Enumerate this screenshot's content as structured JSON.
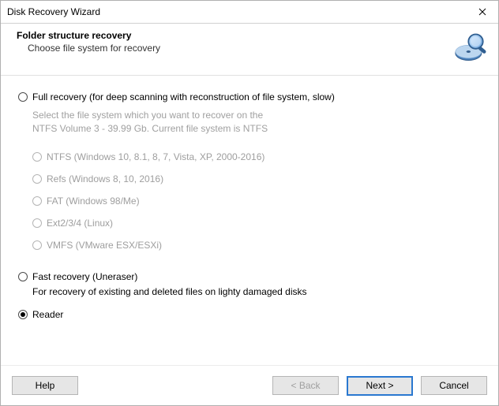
{
  "window": {
    "title": "Disk Recovery Wizard"
  },
  "header": {
    "title": "Folder structure recovery",
    "subtitle": "Choose file system for recovery"
  },
  "options": {
    "full": {
      "label": "Full recovery (for deep scanning with reconstruction of file system, slow)",
      "desc_line1": "Select the file system which you want to recover on the",
      "desc_line2": "NTFS Volume 3 - 39.99 Gb. Current file system is NTFS",
      "fs": {
        "ntfs": "NTFS (Windows 10, 8.1, 8, 7, Vista, XP, 2000-2016)",
        "refs": "Refs (Windows 8, 10, 2016)",
        "fat": "FAT (Windows 98/Me)",
        "ext": "Ext2/3/4 (Linux)",
        "vmfs": "VMFS (VMware ESX/ESXi)"
      }
    },
    "fast": {
      "label": "Fast recovery (Uneraser)",
      "desc": "For recovery of existing and deleted files on lighty damaged disks"
    },
    "reader": {
      "label": "Reader"
    },
    "selected": "reader"
  },
  "buttons": {
    "help": "Help",
    "back": "< Back",
    "next": "Next >",
    "cancel": "Cancel"
  }
}
